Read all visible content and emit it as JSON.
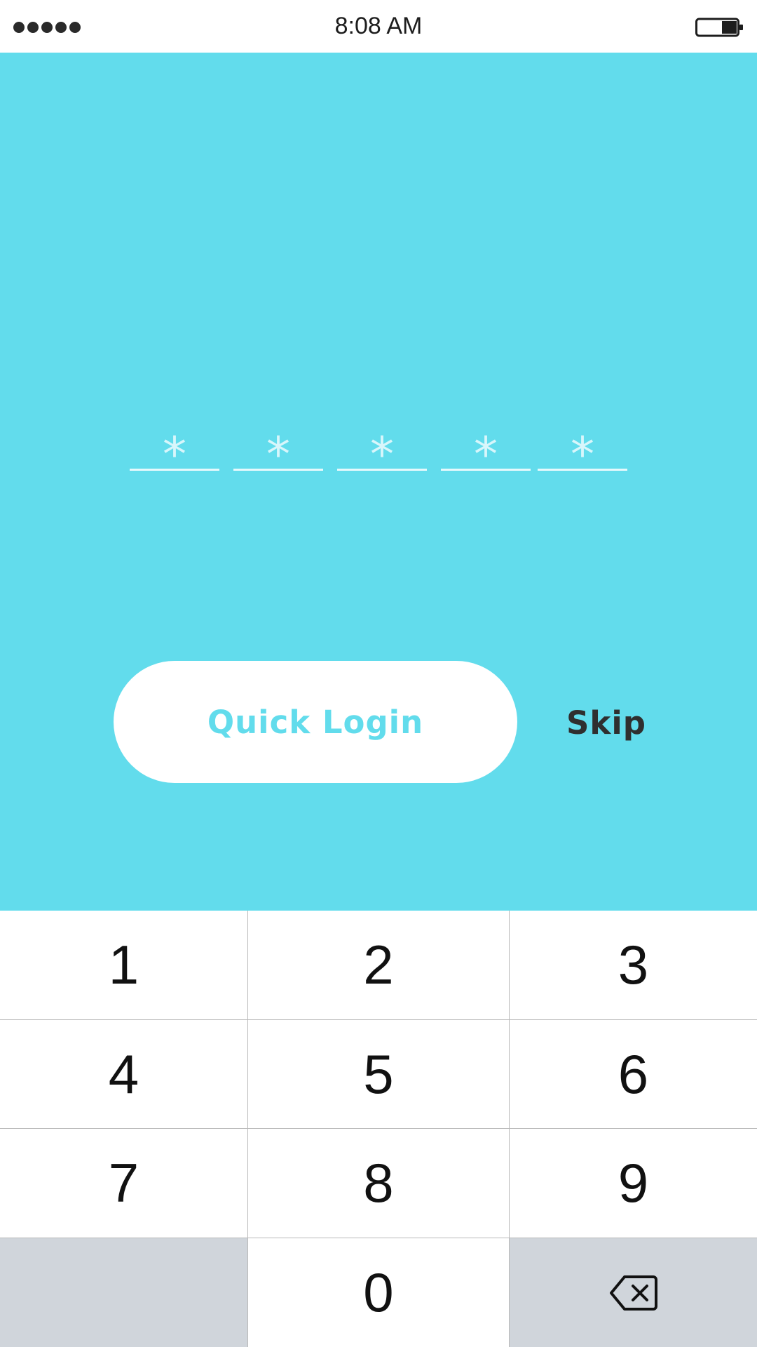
{
  "status_bar": {
    "time": "8:08 AM",
    "signal_icon": "signal-dots-icon",
    "battery_icon": "battery-icon"
  },
  "pin": {
    "digits": [
      "*",
      "*",
      "*",
      "*",
      "*"
    ]
  },
  "actions": {
    "quick_login_label": "Quick Login",
    "skip_label": "Skip"
  },
  "keypad": {
    "keys": [
      "1",
      "2",
      "3",
      "4",
      "5",
      "6",
      "7",
      "8",
      "9",
      "",
      "0"
    ],
    "backspace_icon": "backspace-icon"
  },
  "colors": {
    "accent": "#62dcec",
    "keypad_gray": "#d0d5db",
    "text_dark": "#2f2f2f"
  }
}
